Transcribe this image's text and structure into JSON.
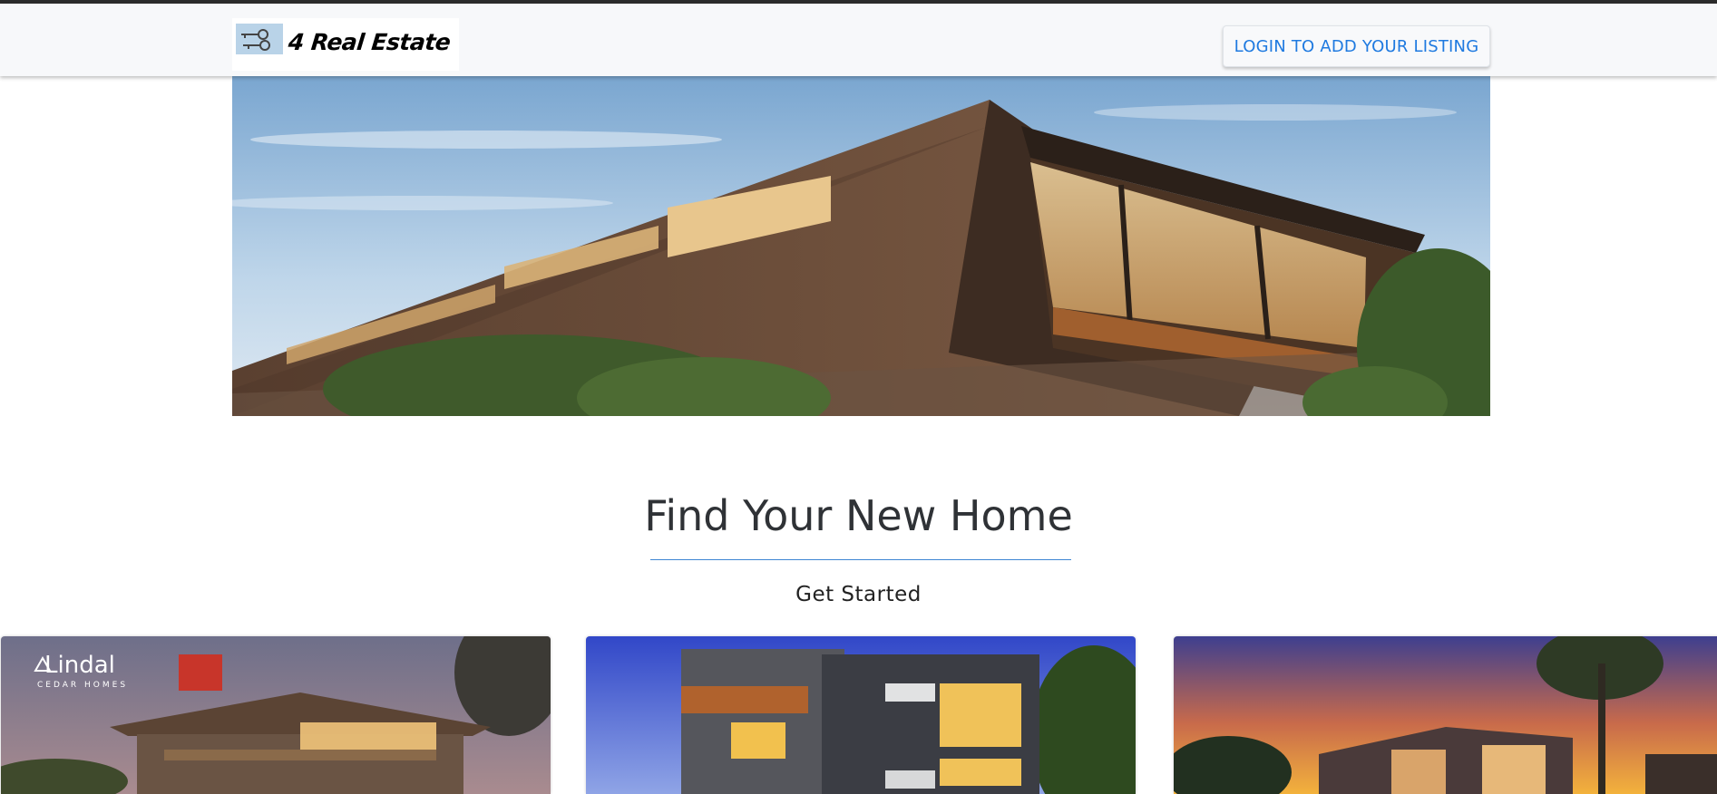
{
  "header": {
    "logo_text": "4 Real Estate",
    "login_button_label": "LOGIN TO ADD YOUR LISTING"
  },
  "hero": {
    "image": "modern-house-hero"
  },
  "main": {
    "title": "Find Your New Home",
    "subtitle": "Get Started"
  },
  "cards": [
    {
      "image": "cedar-house-listing",
      "brand_text": "Lindal",
      "brand_subtext": "CEDAR HOMES"
    },
    {
      "image": "modern-townhouse-listing"
    },
    {
      "image": "sunset-villa-listing"
    }
  ],
  "colors": {
    "accent": "#1f7ae0",
    "divider": "#3f86d3",
    "title_text": "#2f3236",
    "topbar_border": "#2b2b2b"
  }
}
